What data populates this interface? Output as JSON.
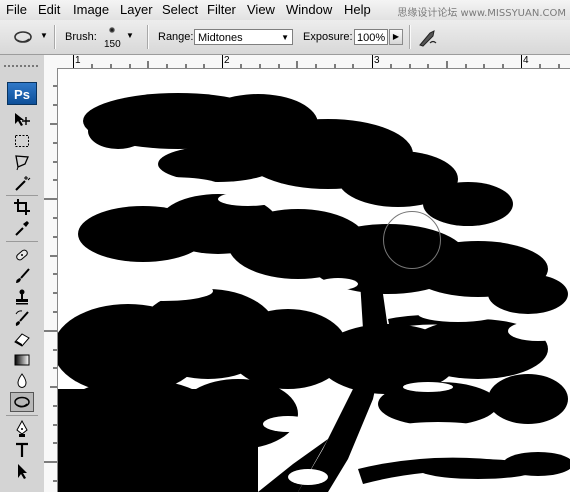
{
  "menu": [
    "File",
    "Edit",
    "Image",
    "Layer",
    "Select",
    "Filter",
    "View",
    "Window",
    "Help"
  ],
  "watermark": "思缘设计论坛 www.MISSYUAN.COM",
  "options": {
    "brush_label": "Brush:",
    "brush_size": "150",
    "range_label": "Range:",
    "range_value": "Midtones",
    "exposure_label": "Exposure:",
    "exposure_value": "100%"
  },
  "app_logo": "Ps",
  "ruler": {
    "h_numbers": [
      "1",
      "2",
      "3",
      "4"
    ]
  },
  "icons": {
    "current_tool": "burn-tool-icon",
    "tools": [
      "move-icon",
      "marquee-icon",
      "lasso-icon",
      "magic-wand-icon",
      "crop-icon",
      "eyedropper-icon",
      "healing-brush-icon",
      "brush-icon",
      "clone-stamp-icon",
      "history-brush-icon",
      "eraser-icon",
      "gradient-icon",
      "blur-icon",
      "burn-icon",
      "pen-icon",
      "type-icon",
      "path-select-icon"
    ]
  },
  "colors": {
    "canvas_subject": "#000000",
    "brand": "#1a5fab"
  }
}
